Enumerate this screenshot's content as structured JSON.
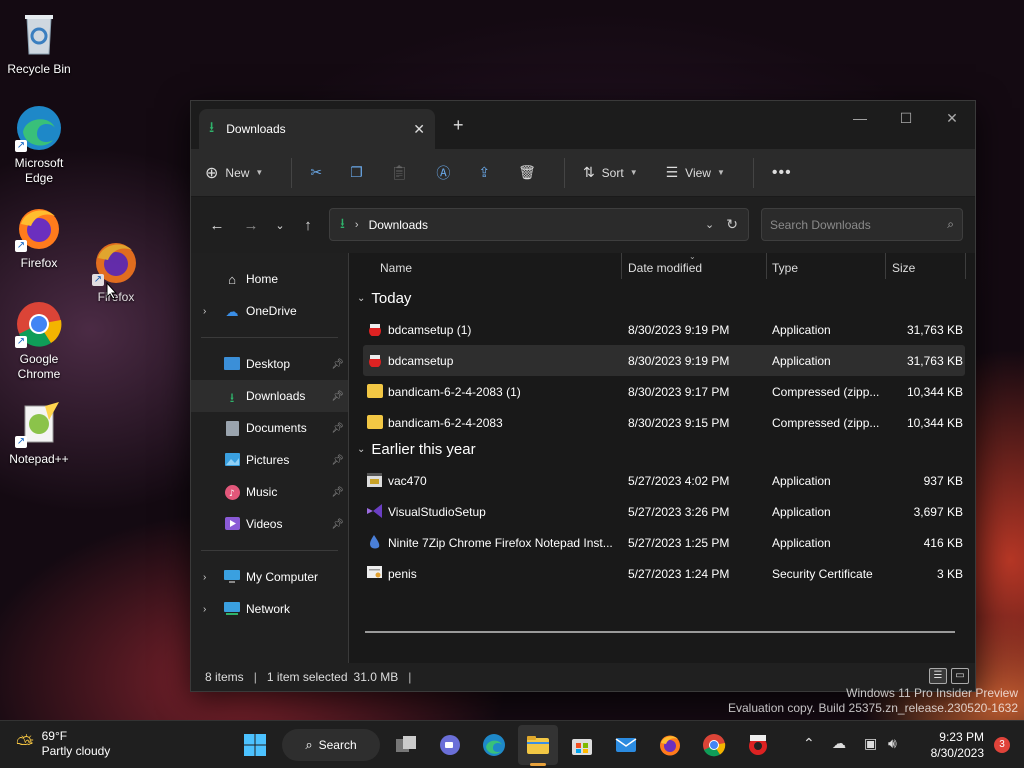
{
  "desktop": {
    "icons": [
      {
        "label": "Recycle Bin"
      },
      {
        "label": "Microsoft Edge"
      },
      {
        "label": "Firefox"
      },
      {
        "label": "Firefox"
      },
      {
        "label": "Google Chrome"
      },
      {
        "label": "Notepad++"
      }
    ]
  },
  "window": {
    "tab_title": "Downloads",
    "toolbar": {
      "new_label": "New",
      "sort_label": "Sort",
      "view_label": "View"
    },
    "address": {
      "path": "Downloads"
    },
    "search": {
      "placeholder": "Search Downloads"
    },
    "nav": {
      "home": "Home",
      "onedrive": "OneDrive",
      "desktop": "Desktop",
      "downloads": "Downloads",
      "documents": "Documents",
      "pictures": "Pictures",
      "music": "Music",
      "videos": "Videos",
      "mycomputer": "My Computer",
      "network": "Network"
    },
    "columns": {
      "name": "Name",
      "date": "Date modified",
      "type": "Type",
      "size": "Size"
    },
    "groups": [
      {
        "label": "Today",
        "files": [
          {
            "name": "bdcamsetup (1)",
            "date": "8/30/2023 9:19 PM",
            "type": "Application",
            "size": "31,763 KB"
          },
          {
            "name": "bdcamsetup",
            "date": "8/30/2023 9:19 PM",
            "type": "Application",
            "size": "31,763 KB"
          },
          {
            "name": "bandicam-6-2-4-2083 (1)",
            "date": "8/30/2023 9:17 PM",
            "type": "Compressed (zipp...",
            "size": "10,344 KB"
          },
          {
            "name": "bandicam-6-2-4-2083",
            "date": "8/30/2023 9:15 PM",
            "type": "Compressed (zipp...",
            "size": "10,344 KB"
          }
        ]
      },
      {
        "label": "Earlier this year",
        "files": [
          {
            "name": "vac470",
            "date": "5/27/2023 4:02 PM",
            "type": "Application",
            "size": "937 KB"
          },
          {
            "name": "VisualStudioSetup",
            "date": "5/27/2023 3:26 PM",
            "type": "Application",
            "size": "3,697 KB"
          },
          {
            "name": "Ninite 7Zip Chrome Firefox Notepad Inst...",
            "date": "5/27/2023 1:25 PM",
            "type": "Application",
            "size": "416 KB"
          },
          {
            "name": "penis",
            "date": "5/27/2023 1:24 PM",
            "type": "Security Certificate",
            "size": "3 KB"
          }
        ]
      }
    ],
    "status": {
      "items": "8 items",
      "selected": "1 item selected",
      "size": "31.0 MB"
    }
  },
  "watermark": {
    "line1": "Windows 11 Pro Insider Preview",
    "line2": "Evaluation copy. Build 25375.zn_release.230520-1632"
  },
  "taskbar": {
    "weather_temp": "69°F",
    "weather_desc": "Partly cloudy",
    "search_label": "Search",
    "time": "9:23 PM",
    "date": "8/30/2023",
    "notifications": "3"
  }
}
